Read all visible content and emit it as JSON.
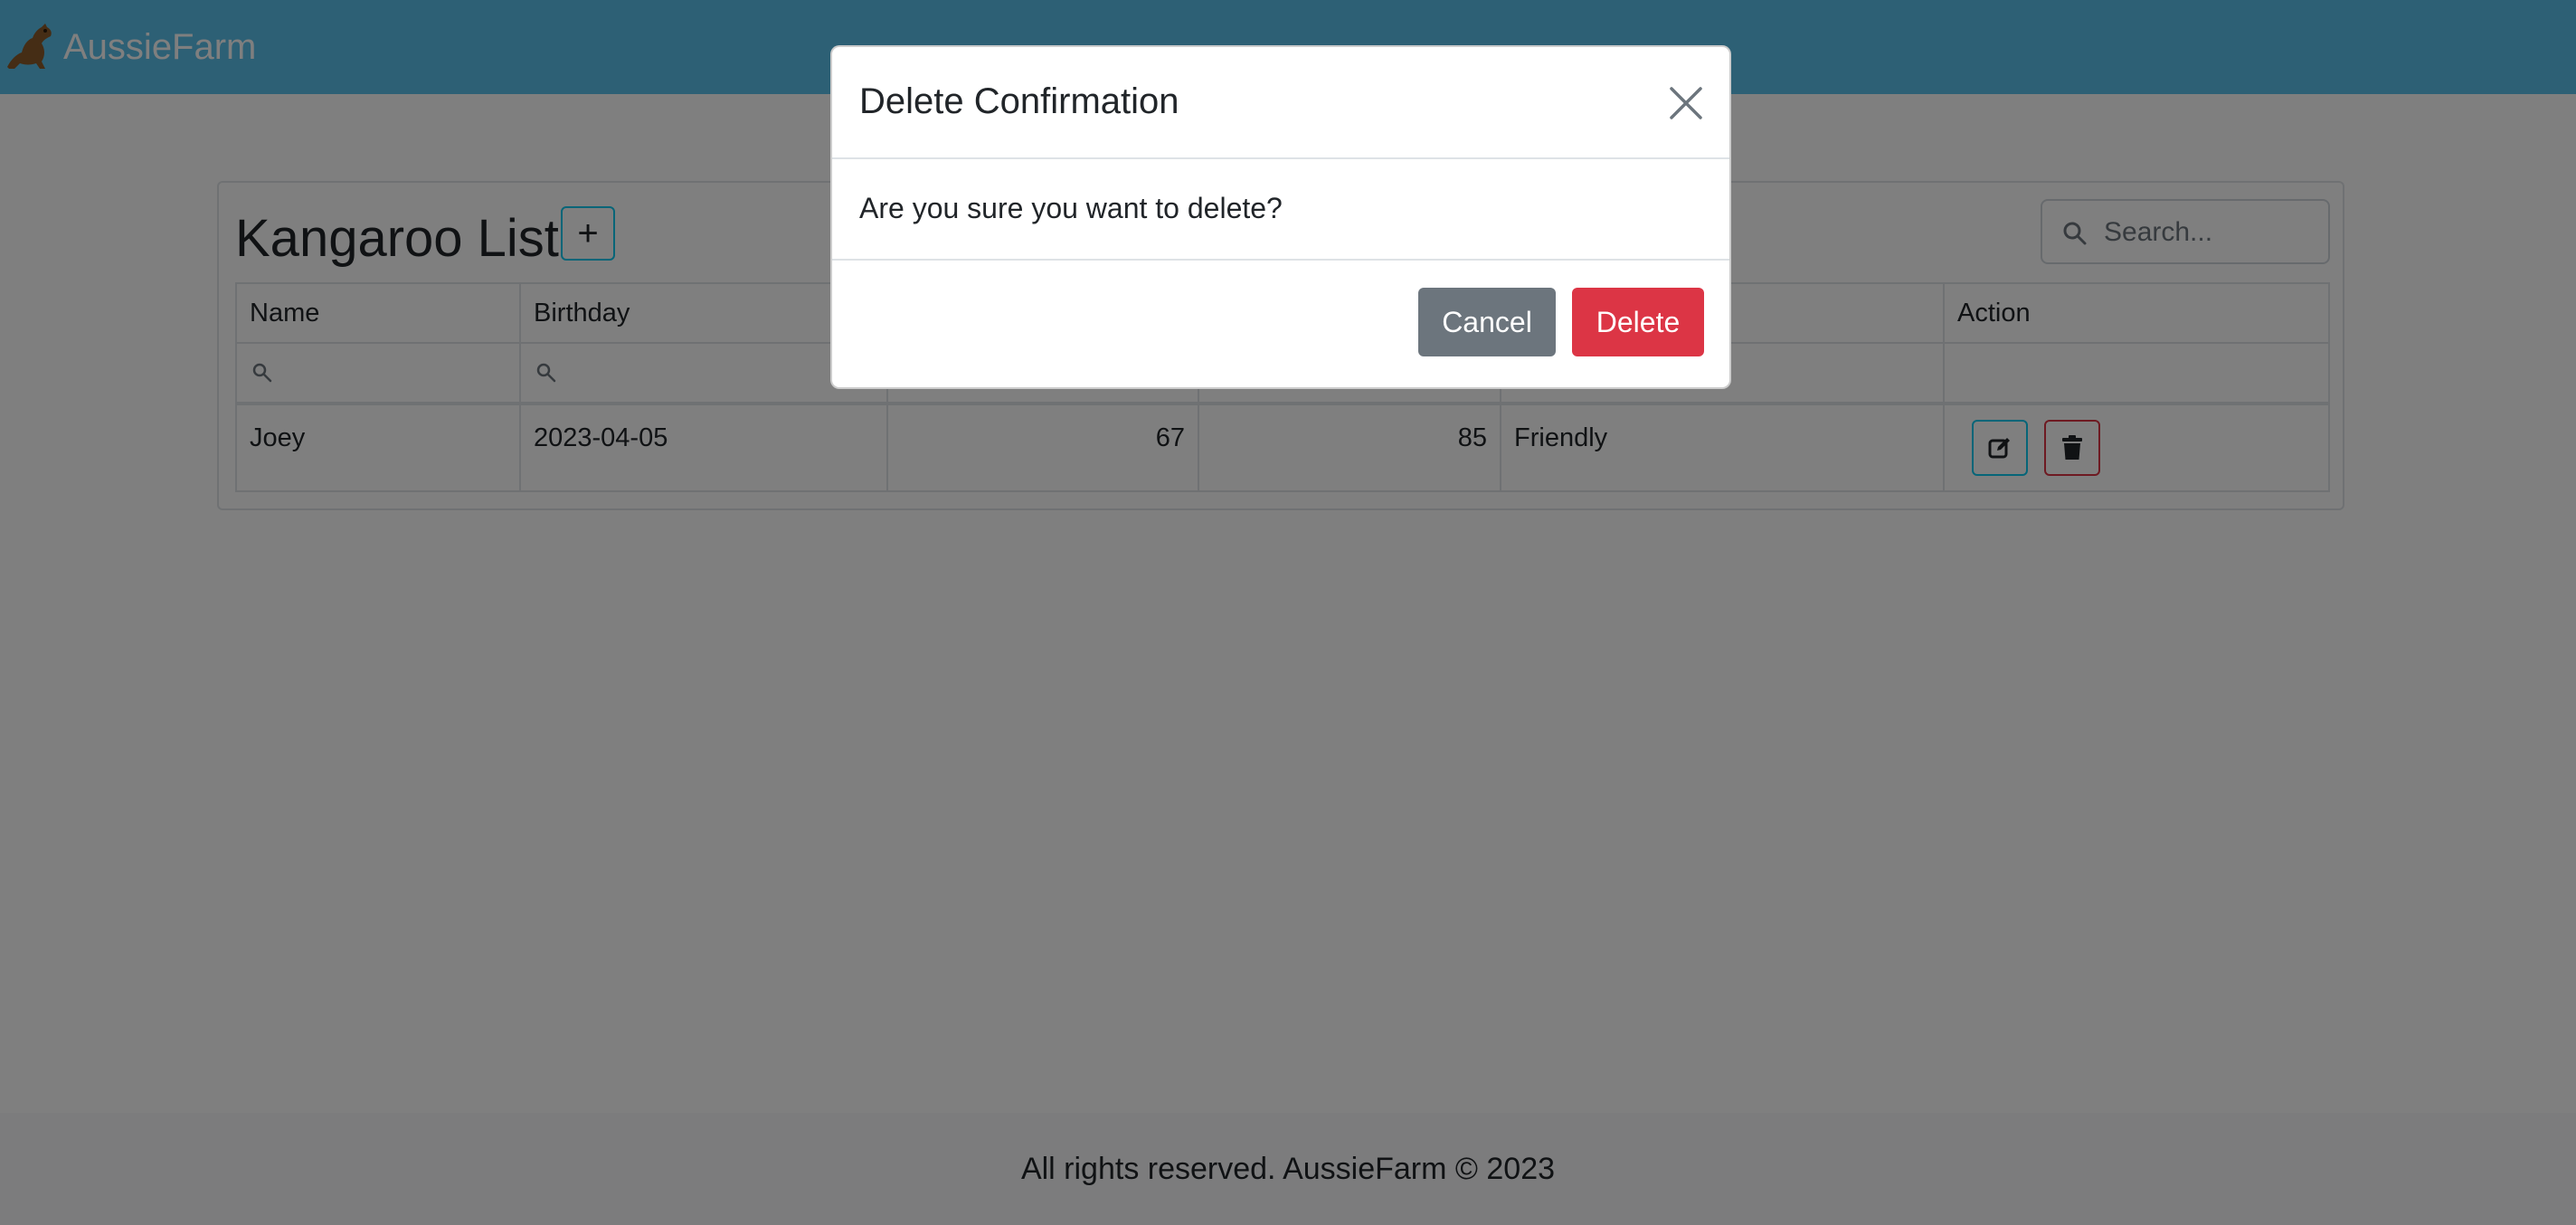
{
  "navbar": {
    "brand": "AussieFarm",
    "logo_icon": "kangaroo-icon",
    "color": "#5bc0eb"
  },
  "page": {
    "title": "Kangaroo List",
    "add_button_label": "+"
  },
  "search": {
    "placeholder": "Search..."
  },
  "table": {
    "columns": [
      "Name",
      "Birthday",
      "",
      "",
      "",
      "Action"
    ],
    "rows": [
      {
        "name": "Joey",
        "birthday": "2023-04-05",
        "value1": "67",
        "value2": "85",
        "temperament": "Friendly"
      }
    ]
  },
  "modal": {
    "title": "Delete Confirmation",
    "message": "Are you sure you want to delete?",
    "cancel_label": "Cancel",
    "delete_label": "Delete",
    "close_icon": "close-icon"
  },
  "footer": {
    "text": "All rights reserved. AussieFarm © 2023"
  },
  "colors": {
    "danger": "#dc3545",
    "secondary": "#6c757d",
    "info": "#0dcaf0"
  }
}
